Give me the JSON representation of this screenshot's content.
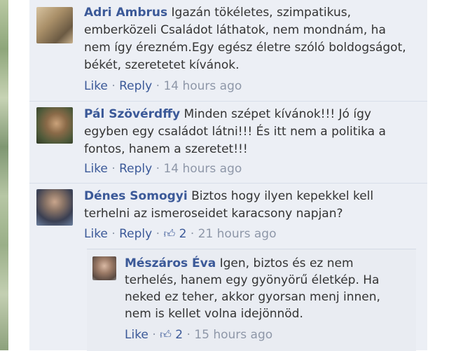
{
  "comments": [
    {
      "author": "Adri Ambrus",
      "text": "Igazán tökéletes, szimpatikus, emberközeli Családot láthatok, nem mondnám, ha nem így érezném.Egy egész életre szóló boldogságot, békét, szeretetet kívánok.",
      "like_label": "Like",
      "reply_label": "Reply",
      "time": "14 hours ago"
    },
    {
      "author": "Pál Szövérdffy",
      "text": "Minden szépet kívánok!!! Jó így egyben egy családot látni!!! És itt nem a politika a fontos, hanem a szeretet!!!",
      "like_label": "Like",
      "reply_label": "Reply",
      "time": "14 hours ago"
    },
    {
      "author": "Dénes Somogyi",
      "text": "Biztos hogy ilyen kepekkel kell terhelni az ismeroseidet karacsony napjan?",
      "like_label": "Like",
      "reply_label": "Reply",
      "like_count": "2",
      "time": "21 hours ago"
    }
  ],
  "reply": {
    "author": "Mészáros Éva",
    "text": "Igen, biztos és ez nem terhelés, hanem egy gyönyörű életkép. Ha neked ez teher, akkor gyorsan menj innen, nem is kellet volna idejönnöd.",
    "like_label": "Like",
    "like_count": "2",
    "time": "15 hours ago"
  },
  "separator": "·",
  "thumb_icon": "thumbs-up-icon",
  "colors": {
    "link": "#3b5998",
    "meta": "#8e97a8",
    "background": "#eceff5"
  }
}
